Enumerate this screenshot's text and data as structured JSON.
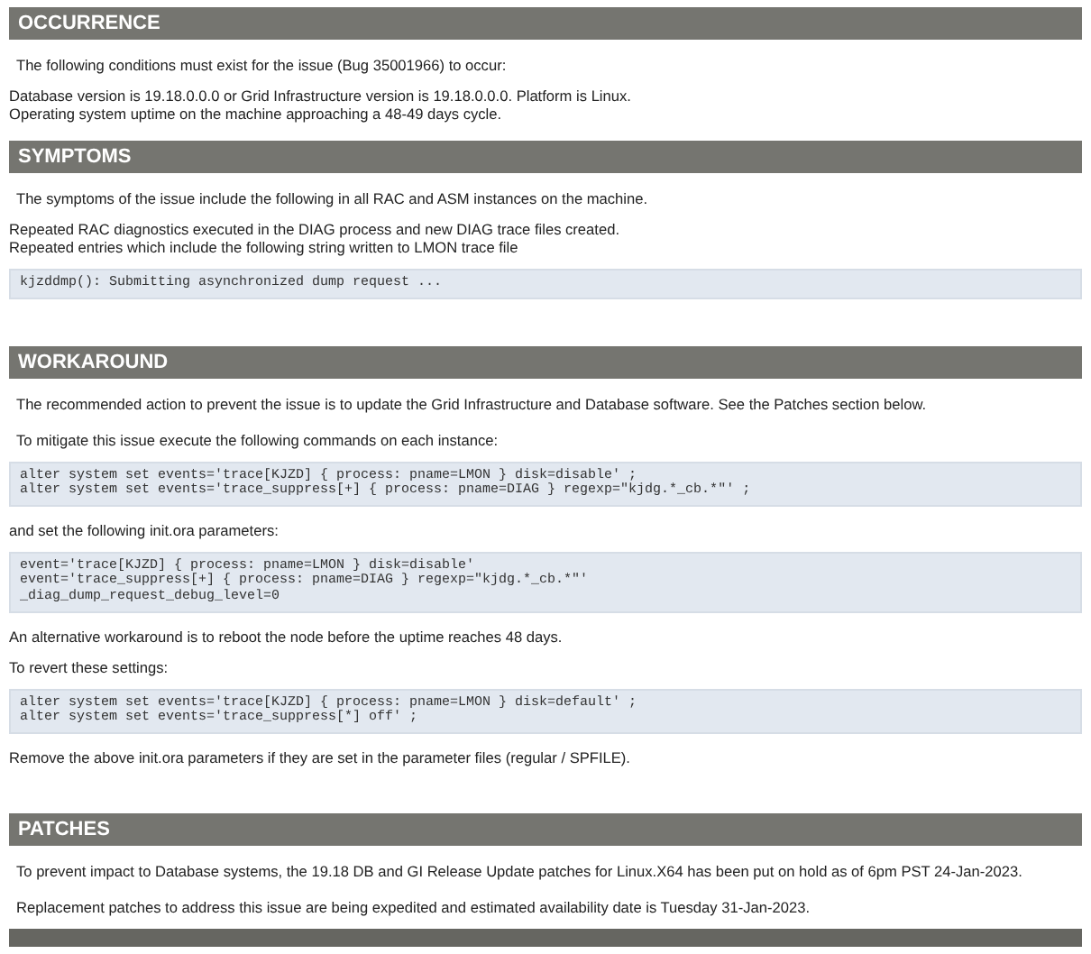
{
  "sections": [
    {
      "title": "OCCURRENCE",
      "blocks": [
        {
          "kind": "lead",
          "text": "The following conditions must exist for the issue (Bug 35001966) to occur:"
        },
        {
          "kind": "lines",
          "lines": [
            "Database version is 19.18.0.0.0 or Grid Infrastructure version is 19.18.0.0.0. Platform is Linux.",
            "Operating system uptime on the machine approaching a 48-49 days cycle."
          ]
        }
      ]
    },
    {
      "title": "SYMPTOMS",
      "blocks": [
        {
          "kind": "lead",
          "text": "The symptoms of the issue include the following in all RAC and ASM instances on the machine."
        },
        {
          "kind": "lines",
          "lines": [
            "Repeated RAC diagnostics executed in the DIAG process and new DIAG trace files created.",
            "Repeated entries which include the following string written to LMON trace file"
          ]
        },
        {
          "kind": "code",
          "lines": [
            "kjzddmp(): Submitting asynchronized dump request ..."
          ]
        }
      ]
    },
    {
      "title": "WORKAROUND",
      "blocks": [
        {
          "kind": "lead",
          "text": "The recommended action to prevent the issue is to update the Grid Infrastructure and Database software. See the Patches section below."
        },
        {
          "kind": "lead",
          "text": "To mitigate this issue execute the following commands on each instance:"
        },
        {
          "kind": "code",
          "lines": [
            "alter system set events='trace[KJZD] { process: pname=LMON } disk=disable' ;",
            "alter system set events='trace_suppress[+] { process: pname=DIAG } regexp=\"kjdg.*_cb.*\"' ;"
          ]
        },
        {
          "kind": "lines",
          "lines": [
            "and set the following init.ora parameters:"
          ]
        },
        {
          "kind": "code",
          "lines": [
            "event='trace[KJZD] { process: pname=LMON } disk=disable'",
            "event='trace_suppress[+] { process: pname=DIAG } regexp=\"kjdg.*_cb.*\"'",
            "_diag_dump_request_debug_level=0"
          ]
        },
        {
          "kind": "lines",
          "lines": [
            "An alternative workaround is to reboot the node before the uptime reaches 48 days."
          ]
        },
        {
          "kind": "lines",
          "lines": [
            "To revert these settings:"
          ]
        },
        {
          "kind": "code",
          "lines": [
            "alter system set events='trace[KJZD] { process: pname=LMON } disk=default' ;",
            "alter system set events='trace_suppress[*] off' ;"
          ]
        },
        {
          "kind": "lines",
          "lines": [
            "Remove the above init.ora parameters if they are set in the parameter files (regular / SPFILE)."
          ]
        }
      ]
    },
    {
      "title": "PATCHES",
      "blocks": [
        {
          "kind": "lead",
          "text": "To prevent impact to Database systems, the 19.18 DB and GI Release Update patches for Linux.X64 has been put on hold as of 6pm PST 24-Jan-2023."
        },
        {
          "kind": "lead",
          "text": "Replacement patches to address this issue are being expedited and estimated availability date is Tuesday 31-Jan-2023."
        }
      ]
    }
  ],
  "next_section_cut_off": true
}
